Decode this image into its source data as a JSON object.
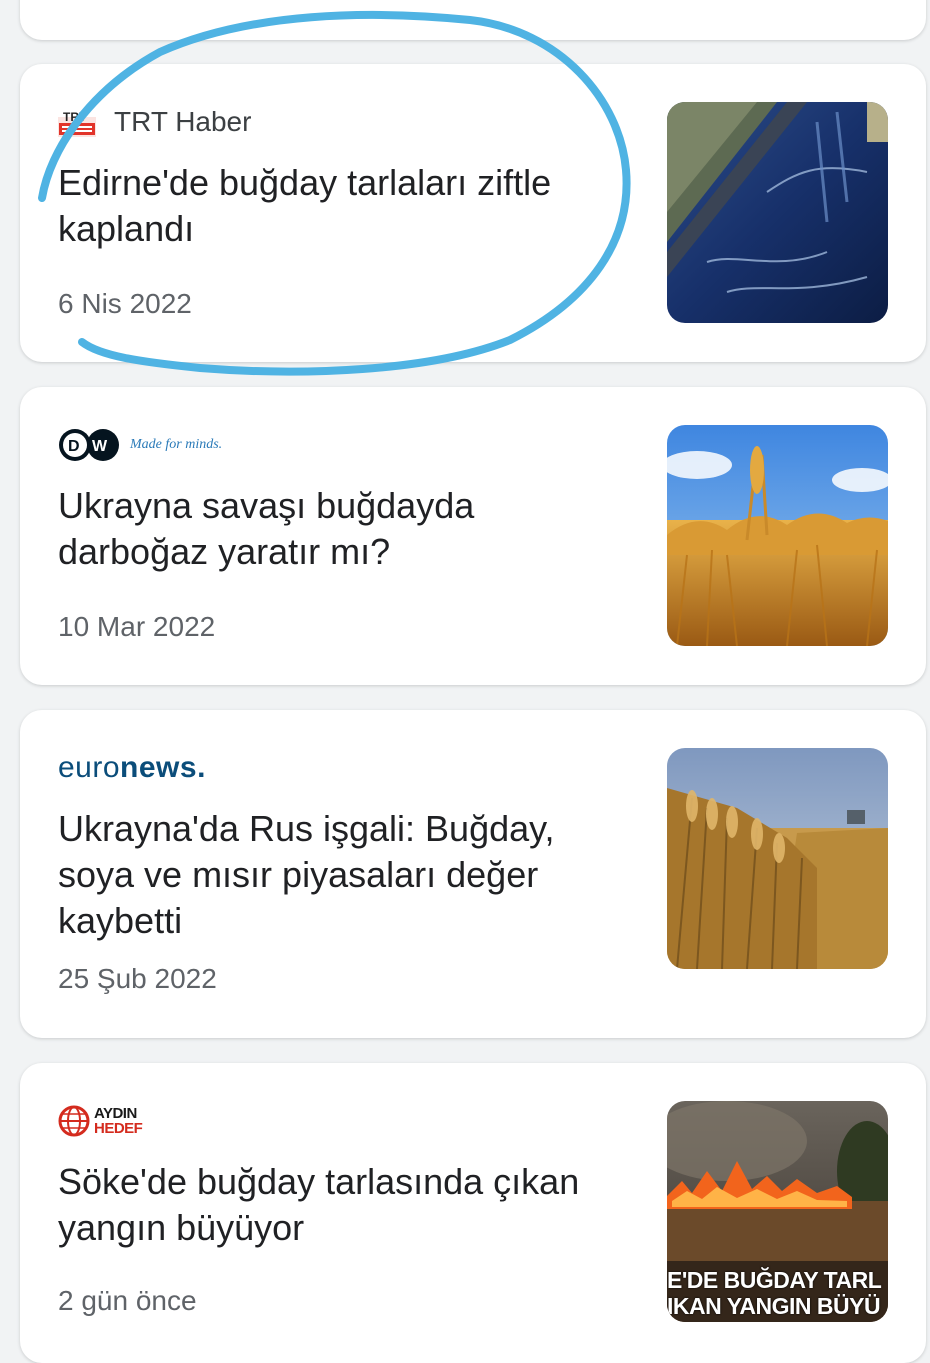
{
  "articles": [
    {
      "source": "TRT Haber",
      "logo_lettering": "TRT",
      "headline_lines": [
        "Edirne'de buğday tarlaları ziftle",
        "kaplandı"
      ],
      "date": "6 Nis 2022",
      "thumb_icon": "tar-covered-field-photo"
    },
    {
      "source_logo": "DW",
      "source_tagline": "Made for minds.",
      "headline_lines": [
        "Ukrayna savaşı buğdayda",
        "darboğaz yaratır mı?"
      ],
      "date": "10 Mar 2022",
      "thumb_icon": "wheat-field-photo"
    },
    {
      "source_light": "euro",
      "source_bold": "news.",
      "headline_lines": [
        "Ukrayna'da Rus işgali: Buğday,",
        "soya ve mısır piyasaları değer",
        "kaybetti"
      ],
      "date": "25 Şub 2022",
      "thumb_icon": "wheat-harvest-photo"
    },
    {
      "source_line1": "AYDIN",
      "source_line2": "HEDEF",
      "headline_lines": [
        "Söke'de buğday tarlasında çıkan",
        "yangın büyüyor"
      ],
      "date": "2 gün önce",
      "thumb_icon": "field-fire-photo",
      "thumb_overlay_line1": "E'DE BUĞDAY TARL",
      "thumb_overlay_line2": "IKAN YANGIN BÜYÜ"
    }
  ],
  "colors": {
    "background": "#f1f3f4",
    "card": "#ffffff",
    "headline": "#202124",
    "date": "#5f6368",
    "annotation_circle": "#4fb3e3"
  }
}
